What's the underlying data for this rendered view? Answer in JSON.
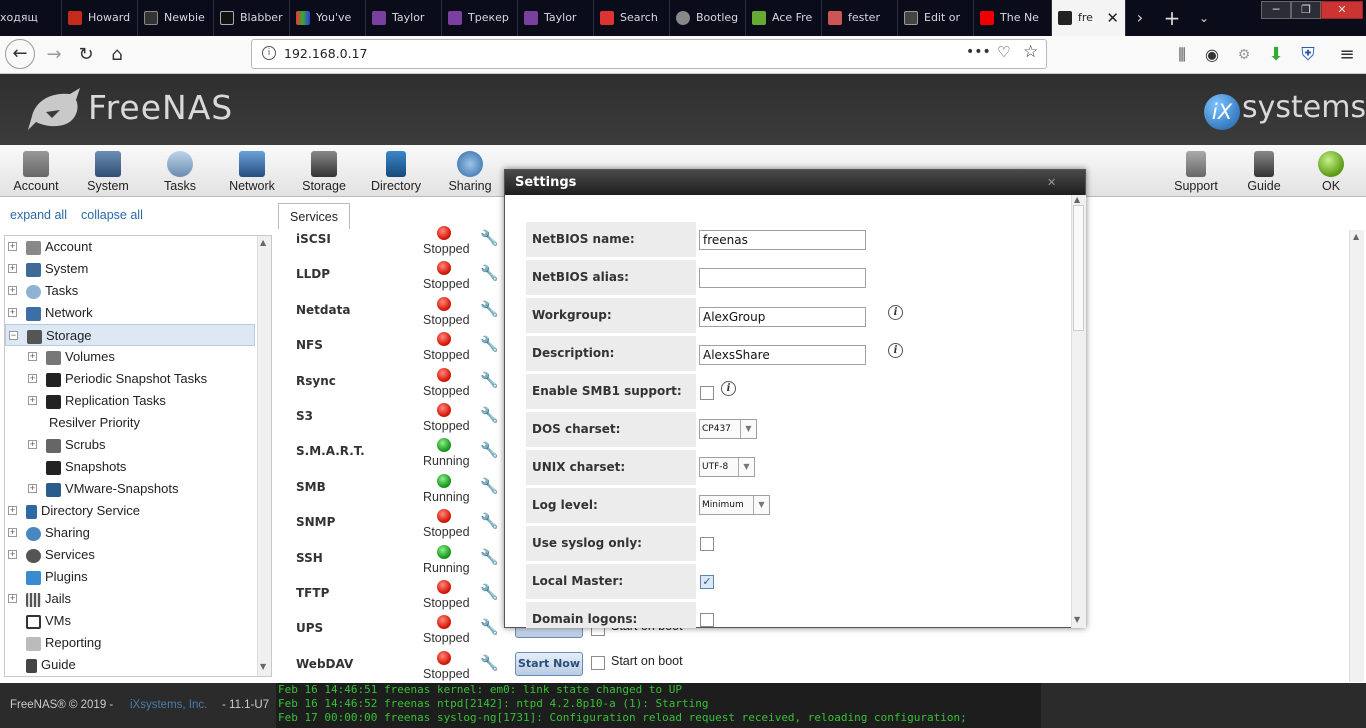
{
  "browser": {
    "tabs": [
      {
        "label": "ходящ",
        "color": "#444"
      },
      {
        "label": "Howard",
        "color": "#c42b1c"
      },
      {
        "label": "Newbie",
        "color": "#333"
      },
      {
        "label": "Blabber",
        "color": "#222"
      },
      {
        "label": "You've",
        "color": "#2a5db0"
      },
      {
        "label": "Taylor",
        "color": "#7b3fa0"
      },
      {
        "label": "Трекер",
        "color": "#7b3fa0"
      },
      {
        "label": "Taylor",
        "color": "#7b3fa0"
      },
      {
        "label": "Search",
        "color": "#d33"
      },
      {
        "label": "Bootleg",
        "color": "#888"
      },
      {
        "label": "Ace Fre",
        "color": "#6a3"
      },
      {
        "label": "fester",
        "color": "#c55"
      },
      {
        "label": "Edit or",
        "color": "#444"
      },
      {
        "label": "The Ne",
        "color": "#e00"
      },
      {
        "label": "fre",
        "color": "#222"
      }
    ],
    "url": "192.168.0.17"
  },
  "header": {
    "logo_text": "FreeNAS",
    "brand_text": "systems",
    "brand_prefix": "iX"
  },
  "toolbar": {
    "items": [
      "Account",
      "System",
      "Tasks",
      "Network",
      "Storage",
      "Directory",
      "Sharing",
      "",
      "",
      "",
      "",
      "",
      "",
      "Support",
      "Guide",
      "OK"
    ]
  },
  "tree": {
    "expand_all": "expand all",
    "collapse_all": "collapse all",
    "items": [
      "Account",
      "System",
      "Tasks",
      "Network",
      "Storage",
      "Volumes",
      "Periodic Snapshot Tasks",
      "Replication Tasks",
      "Resilver Priority",
      "Scrubs",
      "Snapshots",
      "VMware-Snapshots",
      "Directory Service",
      "Sharing",
      "Services",
      "Plugins",
      "Jails",
      "VMs",
      "Reporting",
      "Guide"
    ]
  },
  "services_tab": "Services",
  "services": [
    {
      "name": "iSCSI",
      "status": "Stopped",
      "color": "red"
    },
    {
      "name": "LLDP",
      "status": "Stopped",
      "color": "red"
    },
    {
      "name": "Netdata",
      "status": "Stopped",
      "color": "red"
    },
    {
      "name": "NFS",
      "status": "Stopped",
      "color": "red"
    },
    {
      "name": "Rsync",
      "status": "Stopped",
      "color": "red"
    },
    {
      "name": "S3",
      "status": "Stopped",
      "color": "red"
    },
    {
      "name": "S.M.A.R.T.",
      "status": "Running",
      "color": "green"
    },
    {
      "name": "SMB",
      "status": "Running",
      "color": "green"
    },
    {
      "name": "SNMP",
      "status": "Stopped",
      "color": "red"
    },
    {
      "name": "SSH",
      "status": "Running",
      "color": "green"
    },
    {
      "name": "TFTP",
      "status": "Stopped",
      "color": "red"
    },
    {
      "name": "UPS",
      "status": "Stopped",
      "color": "red"
    },
    {
      "name": "WebDAV",
      "status": "Stopped",
      "color": "red"
    }
  ],
  "start_now": "Start Now",
  "start_on_boot": "Start on boot",
  "dialog": {
    "title": "Settings",
    "fields": {
      "netbios_name": {
        "label": "NetBIOS name:",
        "value": "freenas"
      },
      "netbios_alias": {
        "label": "NetBIOS alias:",
        "value": ""
      },
      "workgroup": {
        "label": "Workgroup:",
        "value": "AlexGroup"
      },
      "description": {
        "label": "Description:",
        "value": "AlexsShare"
      },
      "smb1": {
        "label": "Enable SMB1 support:",
        "checked": false
      },
      "dos_charset": {
        "label": "DOS charset:",
        "value": "CP437"
      },
      "unix_charset": {
        "label": "UNIX charset:",
        "value": "UTF-8"
      },
      "log_level": {
        "label": "Log level:",
        "value": "Minimum"
      },
      "syslog_only": {
        "label": "Use syslog only:",
        "checked": false
      },
      "local_master": {
        "label": "Local Master:",
        "checked": true
      },
      "domain_logons": {
        "label": "Domain logons:",
        "checked": false
      }
    }
  },
  "footer": {
    "copyright": "FreeNAS® © 2019 -",
    "company": "iXsystems, Inc.",
    "version": "- 11.1-U7"
  },
  "console": [
    "Feb 16 14:46:51 freenas kernel: em0: link state changed to UP",
    "Feb 16 14:46:52 freenas ntpd[2142]: ntpd 4.2.8p10-a (1): Starting",
    "Feb 17 00:00:00 freenas syslog-ng[1731]: Configuration reload request received, reloading configuration;"
  ]
}
